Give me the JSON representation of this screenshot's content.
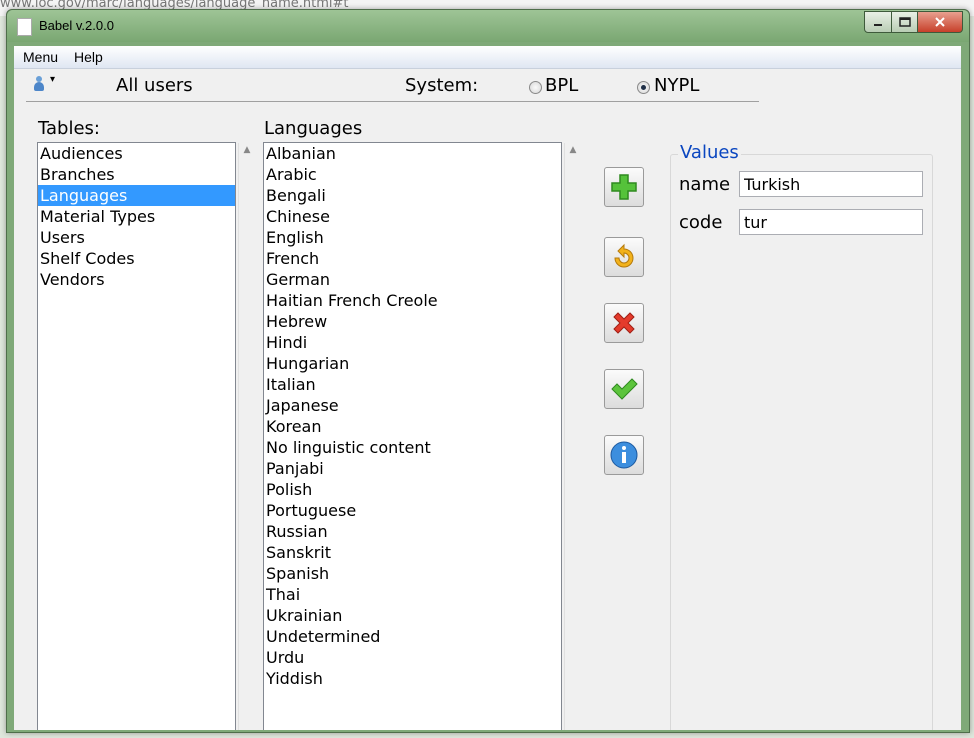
{
  "window": {
    "title": "Babel v.2.0.0"
  },
  "background": {
    "url_text": "www.loc.gov/marc/languages/language_name.html#t"
  },
  "menu": {
    "items": [
      "Menu",
      "Help"
    ]
  },
  "user": {
    "label": "All users",
    "system_label": "System:",
    "systems": [
      "BPL",
      "NYPL"
    ],
    "selected_system": "NYPL"
  },
  "tables": {
    "label": "Tables:",
    "items": [
      "Audiences",
      "Branches",
      "Languages",
      "Material Types",
      "Users",
      "Shelf Codes",
      "Vendors"
    ],
    "selected": "Languages"
  },
  "languages": {
    "label": "Languages",
    "items": [
      "Albanian",
      "Arabic",
      "Bengali",
      "Chinese",
      "English",
      "French",
      "German",
      "Haitian French Creole",
      "Hebrew",
      "Hindi",
      "Hungarian",
      "Italian",
      "Japanese",
      "Korean",
      "No linguistic content",
      "Panjabi",
      "Polish",
      "Portuguese",
      "Russian",
      "Sanskrit",
      "Spanish",
      "Thai",
      "Ukrainian",
      "Undetermined",
      "Urdu",
      "Yiddish"
    ]
  },
  "values": {
    "title": "Values",
    "name_label": "name",
    "name_value": "Turkish",
    "code_label": "code",
    "code_value": "tur"
  },
  "toolbar": {
    "icons": [
      "add-icon",
      "edit-icon",
      "delete-icon",
      "save-icon",
      "info-icon"
    ]
  },
  "colors": {
    "selection": "#3399ff",
    "values_title": "#0a46c0",
    "frame": "#7fa978"
  }
}
